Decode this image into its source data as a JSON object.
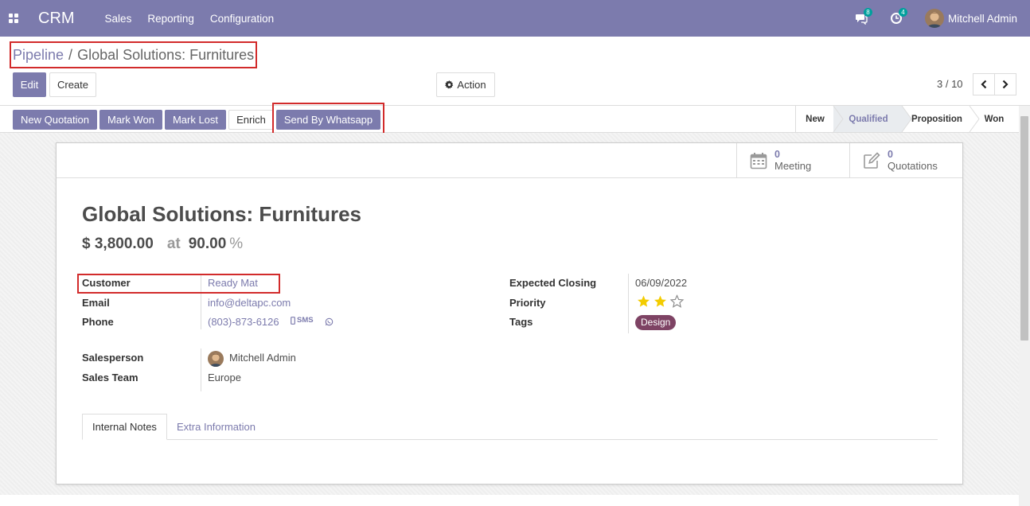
{
  "navbar": {
    "brand": "CRM",
    "menu": [
      "Sales",
      "Reporting",
      "Configuration"
    ],
    "messages_count": "8",
    "activities_count": "4",
    "user_name": "Mitchell Admin"
  },
  "breadcrumb": {
    "parent": "Pipeline",
    "separator": "/",
    "current": "Global Solutions: Furnitures"
  },
  "toolbar": {
    "edit_label": "Edit",
    "create_label": "Create",
    "action_label": "Action",
    "pager": "3 / 10"
  },
  "statusbar": {
    "buttons": [
      "New Quotation",
      "Mark Won",
      "Mark Lost",
      "Enrich",
      "Send By Whatsapp"
    ],
    "stages": [
      "New",
      "Qualified",
      "Proposition",
      "Won"
    ],
    "active_stage": "Qualified"
  },
  "smart_buttons": {
    "meeting": {
      "value": "0",
      "label": "Meeting"
    },
    "quotations": {
      "value": "0",
      "label": "Quotations"
    }
  },
  "record": {
    "title": "Global Solutions: Furnitures",
    "revenue": "$ 3,800.00",
    "at_label": "at",
    "probability": "90.00",
    "percent_sign": "%"
  },
  "fields": {
    "customer_label": "Customer",
    "customer_value": "Ready Mat",
    "email_label": "Email",
    "email_value": "info@deltapc.com",
    "phone_label": "Phone",
    "phone_value": "(803)-873-6126",
    "sms_label": "SMS",
    "salesperson_label": "Salesperson",
    "salesperson_value": "Mitchell Admin",
    "sales_team_label": "Sales Team",
    "sales_team_value": "Europe",
    "expected_closing_label": "Expected Closing",
    "expected_closing_value": "06/09/2022",
    "priority_label": "Priority",
    "priority_value": 2,
    "priority_max": 3,
    "tags_label": "Tags",
    "tags": [
      "Design"
    ]
  },
  "tabs": [
    "Internal Notes",
    "Extra Information"
  ],
  "colors": {
    "brand": "#7c7bad",
    "star_filled": "#f3cc00",
    "tag_design": "#7e4364",
    "highlight": "#d22b2b"
  }
}
